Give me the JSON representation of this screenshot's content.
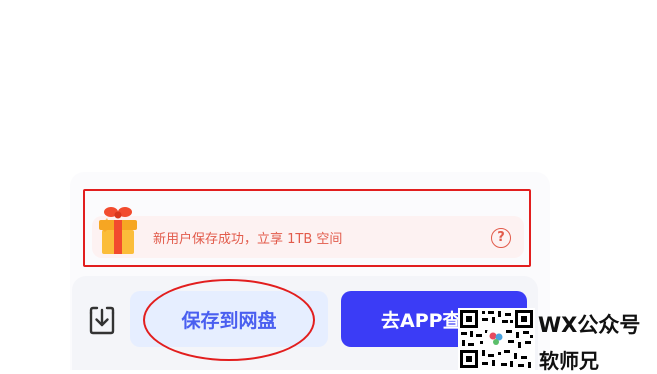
{
  "banner": {
    "text": "新用户保存成功，立享 1TB 空间",
    "help_symbol": "?",
    "icon": "gift-icon",
    "help_icon": "help-circle-icon"
  },
  "actions": {
    "download_icon": "download-icon",
    "save_label": "保存到网盘",
    "app_label": "去APP查看"
  },
  "watermark": {
    "label": "WX公众号",
    "name": "软师兄"
  },
  "colors": {
    "accent": "#3b3cf6",
    "save_text": "#4a5ff0",
    "save_bg": "#e6eeff",
    "banner_text": "#e25b4b",
    "banner_bg": "#fdf2f2",
    "annotation": "#e21e1e"
  }
}
